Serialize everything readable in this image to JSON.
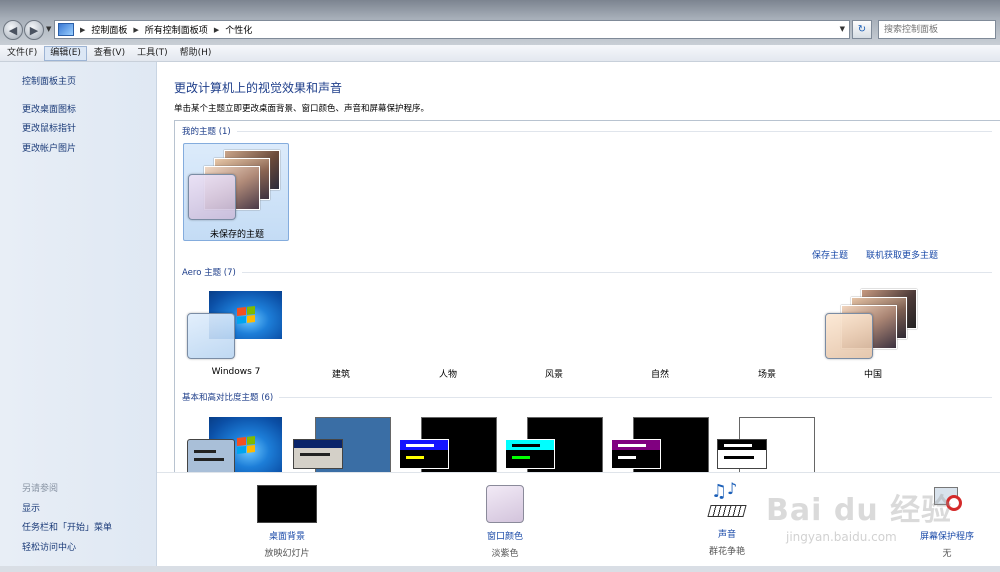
{
  "address_bar": {
    "breadcrumbs": [
      "控制面板",
      "所有控制面板项",
      "个性化"
    ],
    "search_placeholder": "搜索控制面板"
  },
  "menu": [
    "文件(F)",
    "编辑(E)",
    "查看(V)",
    "工具(T)",
    "帮助(H)"
  ],
  "sidebar": {
    "home": "控制面板主页",
    "links": [
      "更改桌面图标",
      "更改鼠标指针",
      "更改帐户图片"
    ],
    "see_also_title": "另请参阅",
    "see_also": [
      "显示",
      "任务栏和「开始」菜单",
      "轻松访问中心"
    ]
  },
  "main": {
    "title": "更改计算机上的视觉效果和声音",
    "description": "单击某个主题立即更改桌面背景、窗口颜色、声音和屏幕保护程序。",
    "my_themes": {
      "header": "我的主题 (1)",
      "items": [
        "未保存的主题"
      ]
    },
    "actions": {
      "save": "保存主题",
      "online": "联机获取更多主题"
    },
    "aero": {
      "header": "Aero 主题 (7)",
      "items": [
        "Windows 7",
        "建筑",
        "人物",
        "风景",
        "自然",
        "场景",
        "中国"
      ]
    },
    "basic": {
      "header": "基本和高对比度主题 (6)"
    }
  },
  "bottom": [
    {
      "label": "桌面背景",
      "sub": "放映幻灯片"
    },
    {
      "label": "窗口颜色",
      "sub": "淡紫色"
    },
    {
      "label": "声音",
      "sub": "群花争艳"
    },
    {
      "label": "屏幕保护程序",
      "sub": "无"
    }
  ],
  "watermark": {
    "logo": "Bai du 经验",
    "url": "jingyan.baidu.com"
  },
  "colors": {
    "link": "#1a4aa8",
    "heading": "#1e3e8a",
    "selected_tile": "#c4dcf5"
  }
}
